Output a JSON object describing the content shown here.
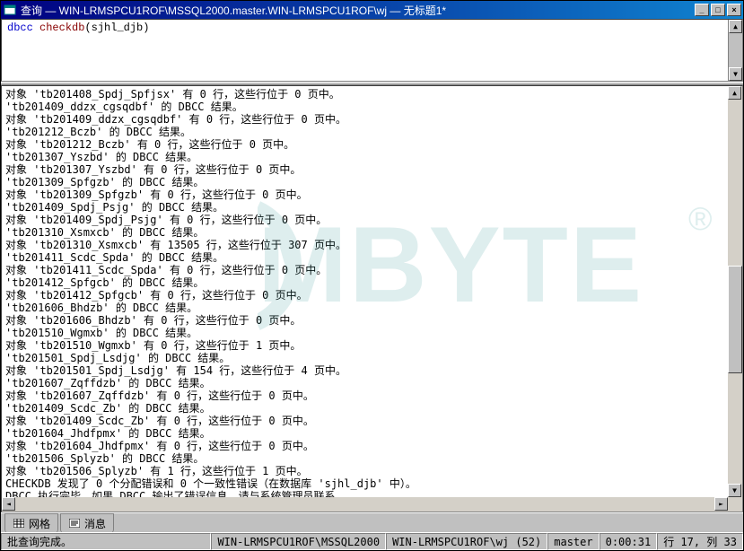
{
  "window": {
    "title": "查询 — WIN-LRMSPCU1ROF\\MSSQL2000.master.WIN-LRMSPCU1ROF\\wj — 无标题1*"
  },
  "editor": {
    "sql_prefix": "dbcc ",
    "sql_proc": "checkdb",
    "sql_args": "(sjhl_djb)"
  },
  "results": {
    "lines": [
      "对象 'tb201408_Spdj_Spfjsx' 有 0 行，这些行位于 0 页中。",
      "'tb201409_ddzx_cgsqdbf' 的 DBCC 结果。",
      "对象 'tb201409_ddzx_cgsqdbf' 有 0 行，这些行位于 0 页中。",
      "'tb201212_Bczb' 的 DBCC 结果。",
      "对象 'tb201212_Bczb' 有 0 行，这些行位于 0 页中。",
      "'tb201307_Yszbd' 的 DBCC 结果。",
      "对象 'tb201307_Yszbd' 有 0 行，这些行位于 0 页中。",
      "'tb201309_Spfgzb' 的 DBCC 结果。",
      "对象 'tb201309_Spfgzb' 有 0 行，这些行位于 0 页中。",
      "'tb201409_Spdj_Psjg' 的 DBCC 结果。",
      "对象 'tb201409_Spdj_Psjg' 有 0 行，这些行位于 0 页中。",
      "'tb201310_Xsmxcb' 的 DBCC 结果。",
      "对象 'tb201310_Xsmxcb' 有 13505 行，这些行位于 307 页中。",
      "'tb201411_Scdc_Spda' 的 DBCC 结果。",
      "对象 'tb201411_Scdc_Spda' 有 0 行，这些行位于 0 页中。",
      "'tb201412_Spfgcb' 的 DBCC 结果。",
      "对象 'tb201412_Spfgcb' 有 0 行，这些行位于 0 页中。",
      "'tb201606_Bhdzb' 的 DBCC 结果。",
      "对象 'tb201606_Bhdzb' 有 0 行，这些行位于 0 页中。",
      "'tb201510_Wgmxb' 的 DBCC 结果。",
      "对象 'tb201510_Wgmxb' 有 0 行，这些行位于 1 页中。",
      "'tb201501_Spdj_Lsdjg' 的 DBCC 结果。",
      "对象 'tb201501_Spdj_Lsdjg' 有 154 行，这些行位于 4 页中。",
      "'tb201607_Zqffdzb' 的 DBCC 结果。",
      "对象 'tb201607_Zqffdzb' 有 0 行，这些行位于 0 页中。",
      "'tb201409_Scdc_Zb' 的 DBCC 结果。",
      "对象 'tb201409_Scdc_Zb' 有 0 行，这些行位于 0 页中。",
      "'tb201604_Jhdfpmx' 的 DBCC 结果。",
      "对象 'tb201604_Jhdfpmx' 有 0 行，这些行位于 0 页中。",
      "'tb201506_Splyzb' 的 DBCC 结果。",
      "对象 'tb201506_Splyzb' 有 1 行，这些行位于 1 页中。",
      "CHECKDB 发现了 0 个分配错误和 0 个一致性错误（在数据库 'sjhl_djb' 中）。",
      "DBCC 执行完毕。如果 DBCC 输出了错误信息，请与系统管理员联系。",
      ""
    ]
  },
  "tabs": {
    "grid": "网格",
    "messages": "消息"
  },
  "status": {
    "msg": "批查询完成。",
    "server": "WIN-LRMSPCU1ROF\\MSSQL2000",
    "user": "WIN-LRMSPCU1ROF\\wj (52)",
    "db": "master",
    "time": "0:00:31",
    "rows": "行 17, 列 33"
  },
  "watermark": {
    "text": "MBYTE",
    "reg": "®"
  }
}
